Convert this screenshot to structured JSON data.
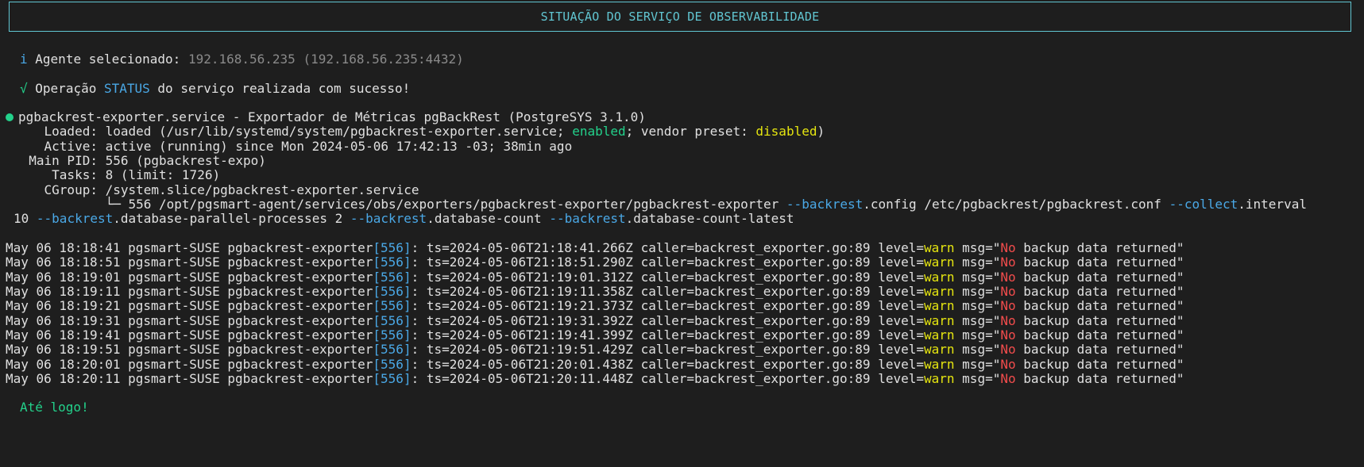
{
  "banner": {
    "title": "SITUAÇÃO DO SERVIÇO DE OBSERVABILIDADE"
  },
  "info": {
    "icon": "i",
    "label": "Agente selecionado:",
    "value": "192.168.56.235 (192.168.56.235:4432)"
  },
  "success": {
    "icon": "√",
    "prefix": "Operação",
    "op": "STATUS",
    "suffix": "do serviço realizada com sucesso!"
  },
  "service": {
    "header": "pgbackrest-exporter.service - Exportador de Métricas pgBackRest (PostgreSYS 3.1.0)",
    "loaded_prefix": "    Loaded: loaded (/usr/lib/systemd/system/pgbackrest-exporter.service; ",
    "loaded_enabled": "enabled",
    "loaded_mid": "; vendor preset: ",
    "loaded_disabled": "disabled",
    "loaded_suffix": ")",
    "active": "    Active: active (running) since Mon 2024-05-06 17:42:13 -03; 38min ago",
    "main_pid": "  Main PID: 556 (pgbackrest-expo)",
    "tasks": "     Tasks: 8 (limit: 1726)",
    "cgroup": "    CGroup: /system.slice/pgbackrest-exporter.service",
    "cmd_prefix": "            └─ 556 /opt/pgsmart-agent/services/obs/exporters/pgbackrest-exporter/pgbackrest-exporter ",
    "cmd_flag1": "--backrest",
    "cmd_mid1": ".config /etc/pgbackrest/pgbackrest.conf ",
    "cmd_flag2": "--collect",
    "cmd_mid2": ".interval",
    "cmd2_prefix": "10 ",
    "cmd2_flag1": "--backrest",
    "cmd2_mid1": ".database-parallel-processes 2 ",
    "cmd2_flag2": "--backrest",
    "cmd2_mid2": ".database-count ",
    "cmd2_flag3": "--backrest",
    "cmd2_mid3": ".database-count-latest"
  },
  "logs": [
    {
      "time": "May 06 18:18:41",
      "host": "pgsmart-SUSE",
      "proc": "pgbackrest-exporter",
      "pid": "[556]",
      "ts": "ts=2024-05-06T21:18:41.266Z",
      "caller": "caller=backrest_exporter.go:89",
      "level_key": "level=",
      "level": "warn",
      "msg_key": "msg=\"",
      "msg_no": "No",
      "msg_rest": " backup data returned\""
    },
    {
      "time": "May 06 18:18:51",
      "host": "pgsmart-SUSE",
      "proc": "pgbackrest-exporter",
      "pid": "[556]",
      "ts": "ts=2024-05-06T21:18:51.290Z",
      "caller": "caller=backrest_exporter.go:89",
      "level_key": "level=",
      "level": "warn",
      "msg_key": "msg=\"",
      "msg_no": "No",
      "msg_rest": " backup data returned\""
    },
    {
      "time": "May 06 18:19:01",
      "host": "pgsmart-SUSE",
      "proc": "pgbackrest-exporter",
      "pid": "[556]",
      "ts": "ts=2024-05-06T21:19:01.312Z",
      "caller": "caller=backrest_exporter.go:89",
      "level_key": "level=",
      "level": "warn",
      "msg_key": "msg=\"",
      "msg_no": "No",
      "msg_rest": " backup data returned\""
    },
    {
      "time": "May 06 18:19:11",
      "host": "pgsmart-SUSE",
      "proc": "pgbackrest-exporter",
      "pid": "[556]",
      "ts": "ts=2024-05-06T21:19:11.358Z",
      "caller": "caller=backrest_exporter.go:89",
      "level_key": "level=",
      "level": "warn",
      "msg_key": "msg=\"",
      "msg_no": "No",
      "msg_rest": " backup data returned\""
    },
    {
      "time": "May 06 18:19:21",
      "host": "pgsmart-SUSE",
      "proc": "pgbackrest-exporter",
      "pid": "[556]",
      "ts": "ts=2024-05-06T21:19:21.373Z",
      "caller": "caller=backrest_exporter.go:89",
      "level_key": "level=",
      "level": "warn",
      "msg_key": "msg=\"",
      "msg_no": "No",
      "msg_rest": " backup data returned\""
    },
    {
      "time": "May 06 18:19:31",
      "host": "pgsmart-SUSE",
      "proc": "pgbackrest-exporter",
      "pid": "[556]",
      "ts": "ts=2024-05-06T21:19:31.392Z",
      "caller": "caller=backrest_exporter.go:89",
      "level_key": "level=",
      "level": "warn",
      "msg_key": "msg=\"",
      "msg_no": "No",
      "msg_rest": " backup data returned\""
    },
    {
      "time": "May 06 18:19:41",
      "host": "pgsmart-SUSE",
      "proc": "pgbackrest-exporter",
      "pid": "[556]",
      "ts": "ts=2024-05-06T21:19:41.399Z",
      "caller": "caller=backrest_exporter.go:89",
      "level_key": "level=",
      "level": "warn",
      "msg_key": "msg=\"",
      "msg_no": "No",
      "msg_rest": " backup data returned\""
    },
    {
      "time": "May 06 18:19:51",
      "host": "pgsmart-SUSE",
      "proc": "pgbackrest-exporter",
      "pid": "[556]",
      "ts": "ts=2024-05-06T21:19:51.429Z",
      "caller": "caller=backrest_exporter.go:89",
      "level_key": "level=",
      "level": "warn",
      "msg_key": "msg=\"",
      "msg_no": "No",
      "msg_rest": " backup data returned\""
    },
    {
      "time": "May 06 18:20:01",
      "host": "pgsmart-SUSE",
      "proc": "pgbackrest-exporter",
      "pid": "[556]",
      "ts": "ts=2024-05-06T21:20:01.438Z",
      "caller": "caller=backrest_exporter.go:89",
      "level_key": "level=",
      "level": "warn",
      "msg_key": "msg=\"",
      "msg_no": "No",
      "msg_rest": " backup data returned\""
    },
    {
      "time": "May 06 18:20:11",
      "host": "pgsmart-SUSE",
      "proc": "pgbackrest-exporter",
      "pid": "[556]",
      "ts": "ts=2024-05-06T21:20:11.448Z",
      "caller": "caller=backrest_exporter.go:89",
      "level_key": "level=",
      "level": "warn",
      "msg_key": "msg=\"",
      "msg_no": "No",
      "msg_rest": " backup data returned\""
    }
  ],
  "footer": {
    "goodbye": "Até logo!"
  },
  "colors": {
    "background": "#1e1e1e",
    "banner": "#61c6d2",
    "info": "#4aa8e6",
    "success": "#23d18b",
    "warn": "#e5e510",
    "error": "#f14c4c",
    "dim": "#8a8a8a"
  }
}
